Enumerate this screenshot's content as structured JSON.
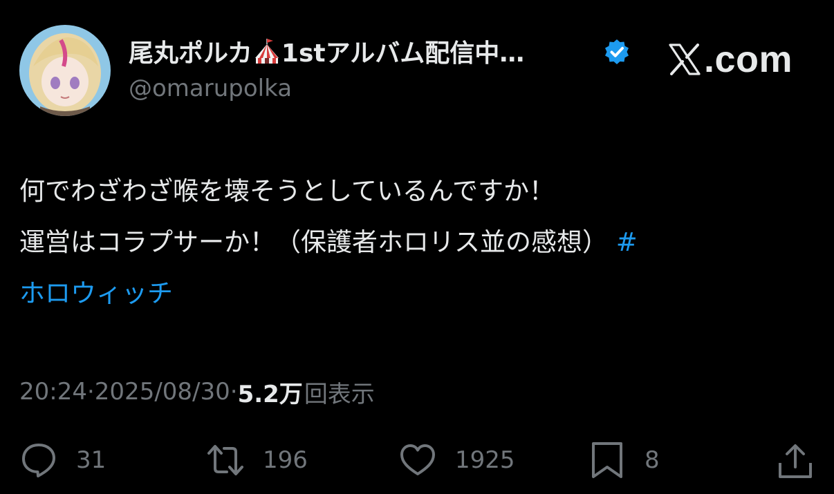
{
  "card": {
    "avatar_alt": "avatar",
    "display_name_part1": "尾丸ポルカ",
    "display_name_emoji_icon": "circus-tent-icon",
    "display_name_part2": "1stアルバム配信中…",
    "verified_icon": "verified-badge-icon",
    "handle": "@omarupolka",
    "brand": {
      "logo_icon": "x-logo-icon",
      "suffix": ".com"
    }
  },
  "tweet": {
    "line1": "何でわざわざ喉を壊そうとしているんですか！",
    "line2_text": "運営はコラプサーか！（保護者ホロリス並の感想） ",
    "hashtag_mark": "#",
    "hashtag_text": "ホロウィッチ"
  },
  "meta": {
    "time": "20:24",
    "sep1": " · ",
    "date": "2025/08/30",
    "sep2": " · ",
    "views_count": "5.2万",
    "views_label": "回表示"
  },
  "actions": {
    "replies": "31",
    "reposts": "196",
    "likes": "1925",
    "bookmarks": "8"
  },
  "colors": {
    "background": "#000000",
    "text": "#e7e9ea",
    "secondary": "#71767b",
    "accent": "#1d9bf0"
  }
}
